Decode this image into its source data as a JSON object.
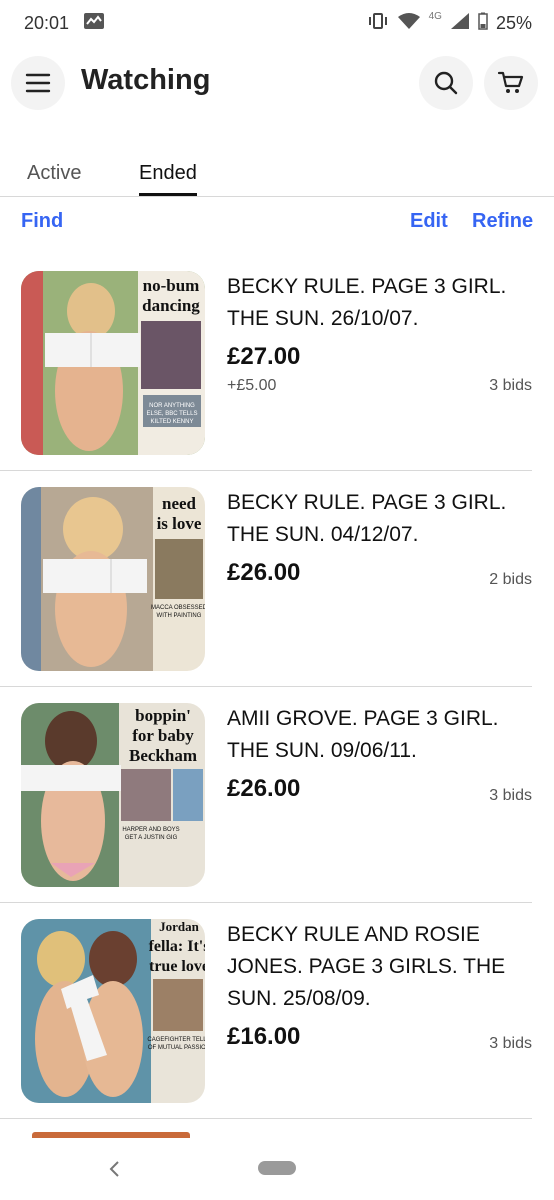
{
  "status_bar": {
    "time": "20:01",
    "network": "4G",
    "battery": "25%"
  },
  "header": {
    "title": "Watching"
  },
  "tabs": [
    {
      "label": "Active",
      "active": false
    },
    {
      "label": "Ended",
      "active": true
    }
  ],
  "toolbar": {
    "find": "Find",
    "edit": "Edit",
    "refine": "Refine"
  },
  "items": [
    {
      "title": "BECKY RULE. PAGE 3 GIRL. THE SUN. 26/10/07.",
      "price": "£27.00",
      "shipping": "+£5.00",
      "bids": "3 bids",
      "thumb": {
        "headline": "no-bum dancing",
        "caption": "NOR ANYTHING ELSE, BBC TELLS KILTED KENNY",
        "side": "BECKY, 24, from..."
      }
    },
    {
      "title": "BECKY RULE. PAGE 3 GIRL. THE SUN. 04/12/07.",
      "price": "£26.00",
      "shipping": "",
      "bids": "2 bids",
      "thumb": {
        "headline": "need is love",
        "caption": "MACCA OBSESSED WITH PAINTING",
        "side": "BECKY, 24, fro"
      }
    },
    {
      "title": "AMII GROVE. PAGE 3 GIRL. THE SUN. 09/06/11.",
      "price": "£26.00",
      "shipping": "",
      "bids": "3 bids",
      "thumb": {
        "headline": "boppin' for baby Beckham",
        "caption": "HARPER AND BOYS GET A JUSTIN GIG",
        "side": "No Noti for baby Gerrard"
      }
    },
    {
      "title": "BECKY RULE AND ROSIE JONES. PAGE 3 GIRLS. THE SUN. 25/08/09.",
      "price": "£16.00",
      "shipping": "",
      "bids": "3 bids",
      "thumb": {
        "headline": "fella: It's true love",
        "caption": "CAGEFIGHTER TELLS OF MUTUAL PASSION",
        "side": "Jordan"
      }
    }
  ],
  "colors": {
    "accent": "#3665f3",
    "text": "#191919",
    "muted": "#555555",
    "divider": "#d8d8d8"
  },
  "icons": [
    "menu-icon",
    "search-icon",
    "cart-icon",
    "back-icon",
    "home-pill-icon"
  ]
}
